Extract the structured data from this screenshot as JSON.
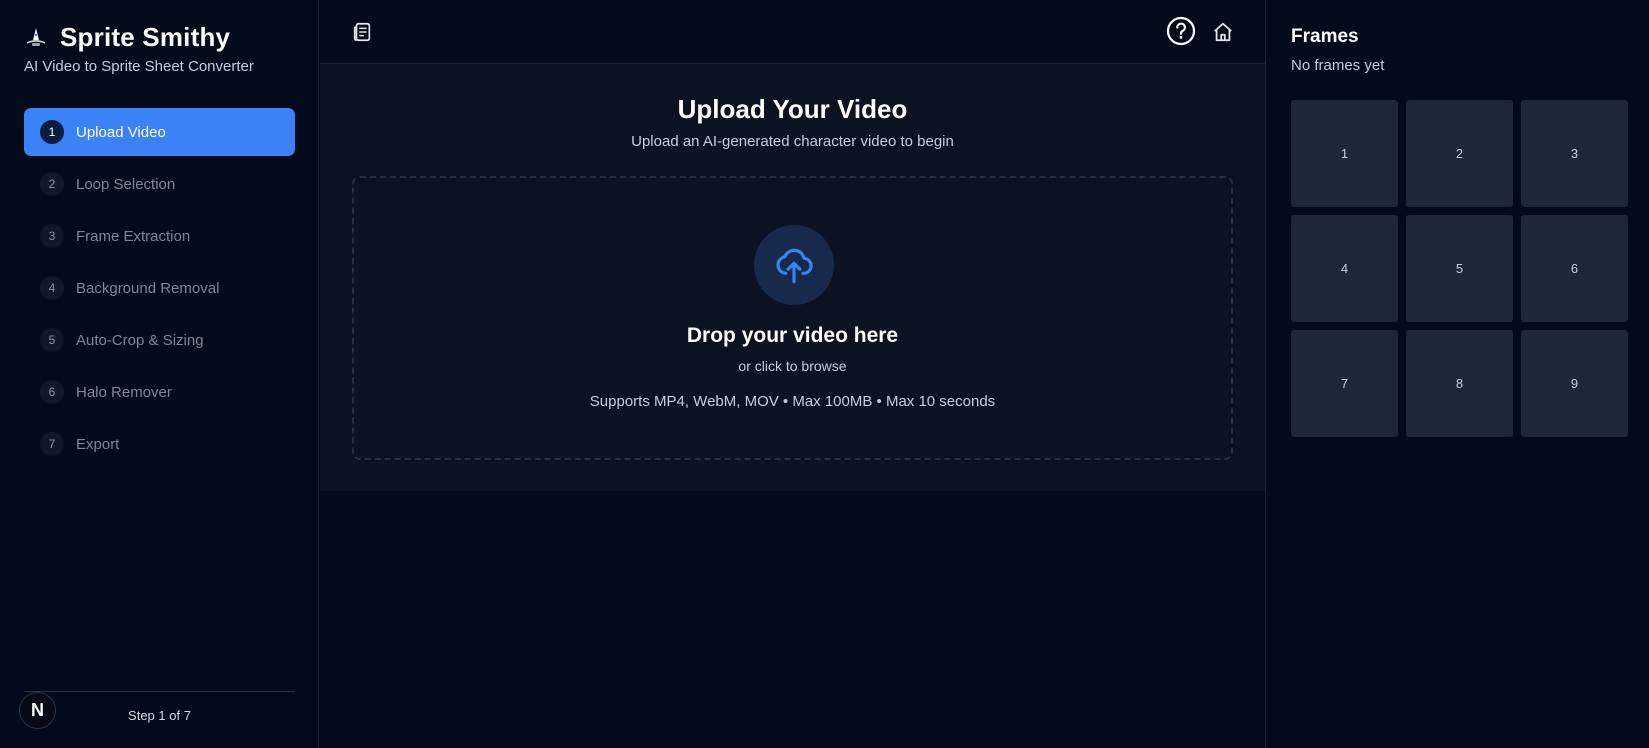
{
  "app": {
    "title": "Sprite Smithy",
    "subtitle": "AI Video to Sprite Sheet Converter"
  },
  "sidebar": {
    "steps": [
      {
        "num": "1",
        "label": "Upload Video",
        "active": true
      },
      {
        "num": "2",
        "label": "Loop Selection",
        "active": false
      },
      {
        "num": "3",
        "label": "Frame Extraction",
        "active": false
      },
      {
        "num": "4",
        "label": "Background Removal",
        "active": false
      },
      {
        "num": "5",
        "label": "Auto-Crop & Sizing",
        "active": false
      },
      {
        "num": "6",
        "label": "Halo Remover",
        "active": false
      },
      {
        "num": "7",
        "label": "Export",
        "active": false
      }
    ],
    "step_counter": "Step 1 of 7",
    "avatar_letter": "N"
  },
  "main": {
    "title": "Upload Your Video",
    "subtitle": "Upload an AI-generated character video to begin",
    "dropzone": {
      "title": "Drop your video here",
      "subtitle": "or click to browse",
      "supports": "Supports MP4, WebM, MOV • Max 100MB • Max 10 seconds"
    }
  },
  "frames": {
    "title": "Frames",
    "status": "No frames yet",
    "cells": [
      "1",
      "2",
      "3",
      "4",
      "5",
      "6",
      "7",
      "8",
      "9"
    ]
  },
  "icons": {
    "brand": "wizard-hat-icon",
    "topbar_left": "documents-icon",
    "help": "help-circle-icon",
    "home": "home-icon",
    "upload": "cloud-upload-icon"
  },
  "colors": {
    "background": "#030a1a",
    "panel": "#0b1222",
    "accent": "#3b82f6",
    "frame_cell": "#1d2738"
  }
}
